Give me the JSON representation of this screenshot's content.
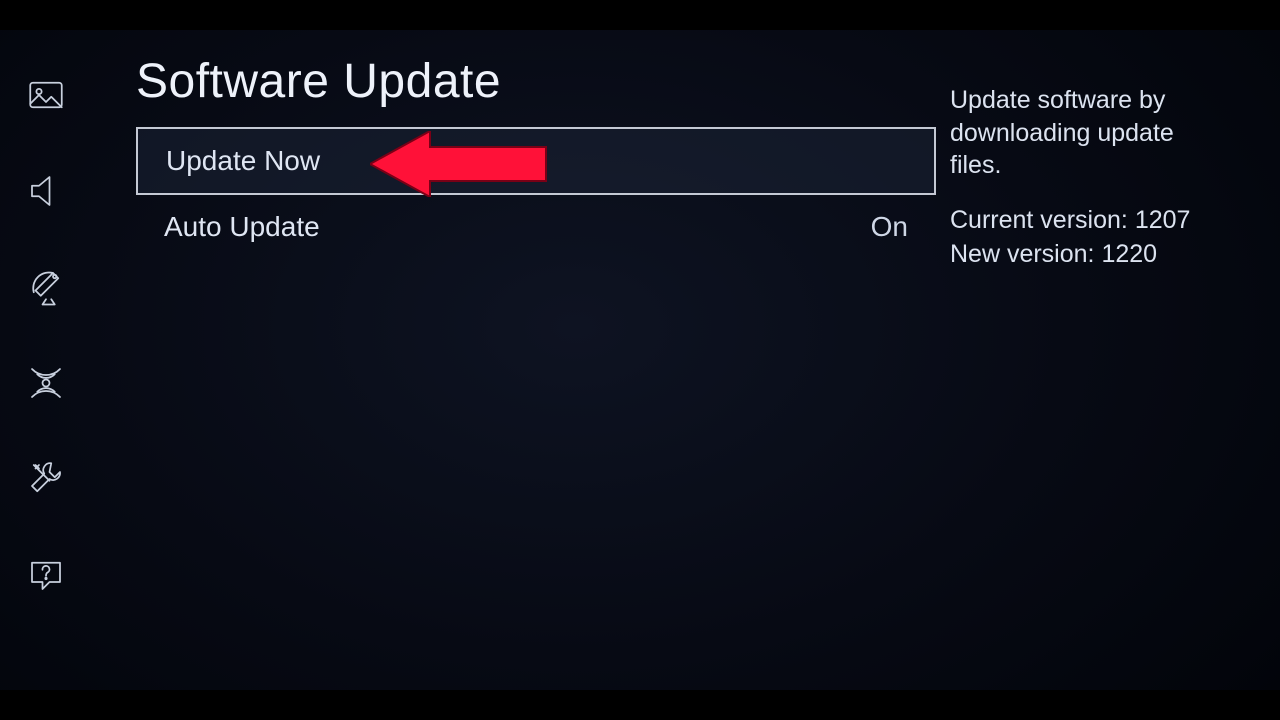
{
  "page_title": "Software Update",
  "menu": {
    "items": [
      {
        "label": "Update Now",
        "value": "",
        "selected": true
      },
      {
        "label": "Auto Update",
        "value": "On",
        "selected": false
      }
    ]
  },
  "info": {
    "description": "Update software by downloading update files.",
    "current_label": "Current version:",
    "current_value": "1207",
    "new_label": "New version:",
    "new_value": "1220"
  },
  "sidebar": {
    "icons": [
      "picture",
      "sound",
      "broadcast",
      "network",
      "system",
      "support"
    ]
  },
  "annotation": {
    "arrow_color": "#ff1138"
  }
}
